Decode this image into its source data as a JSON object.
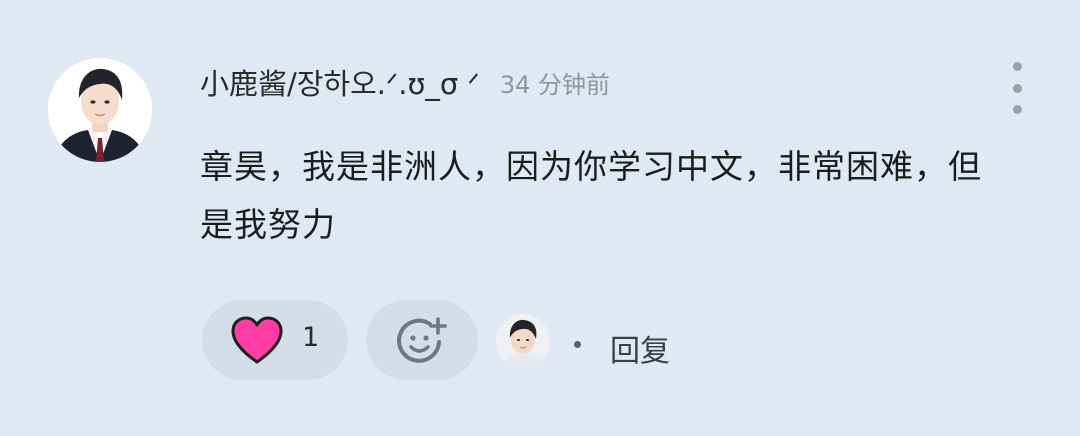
{
  "comment": {
    "username": "小鹿酱/장하오.ᐟ.ʊ_σ ᐟ",
    "timestamp": "34 分钟前",
    "text": "章昊，我是非洲人，因为你学习中文，非常困难，但是我努力",
    "like_count": "1",
    "reply_label": "回复"
  },
  "icons": {
    "like": "heart-icon",
    "add_reaction": "add-reaction-icon",
    "more": "more-vertical-icon"
  },
  "colors": {
    "background": "#dfe8f3",
    "pill_background": "#d3dce7",
    "heart": "#ff3ea5",
    "timestamp": "#8f959d"
  }
}
